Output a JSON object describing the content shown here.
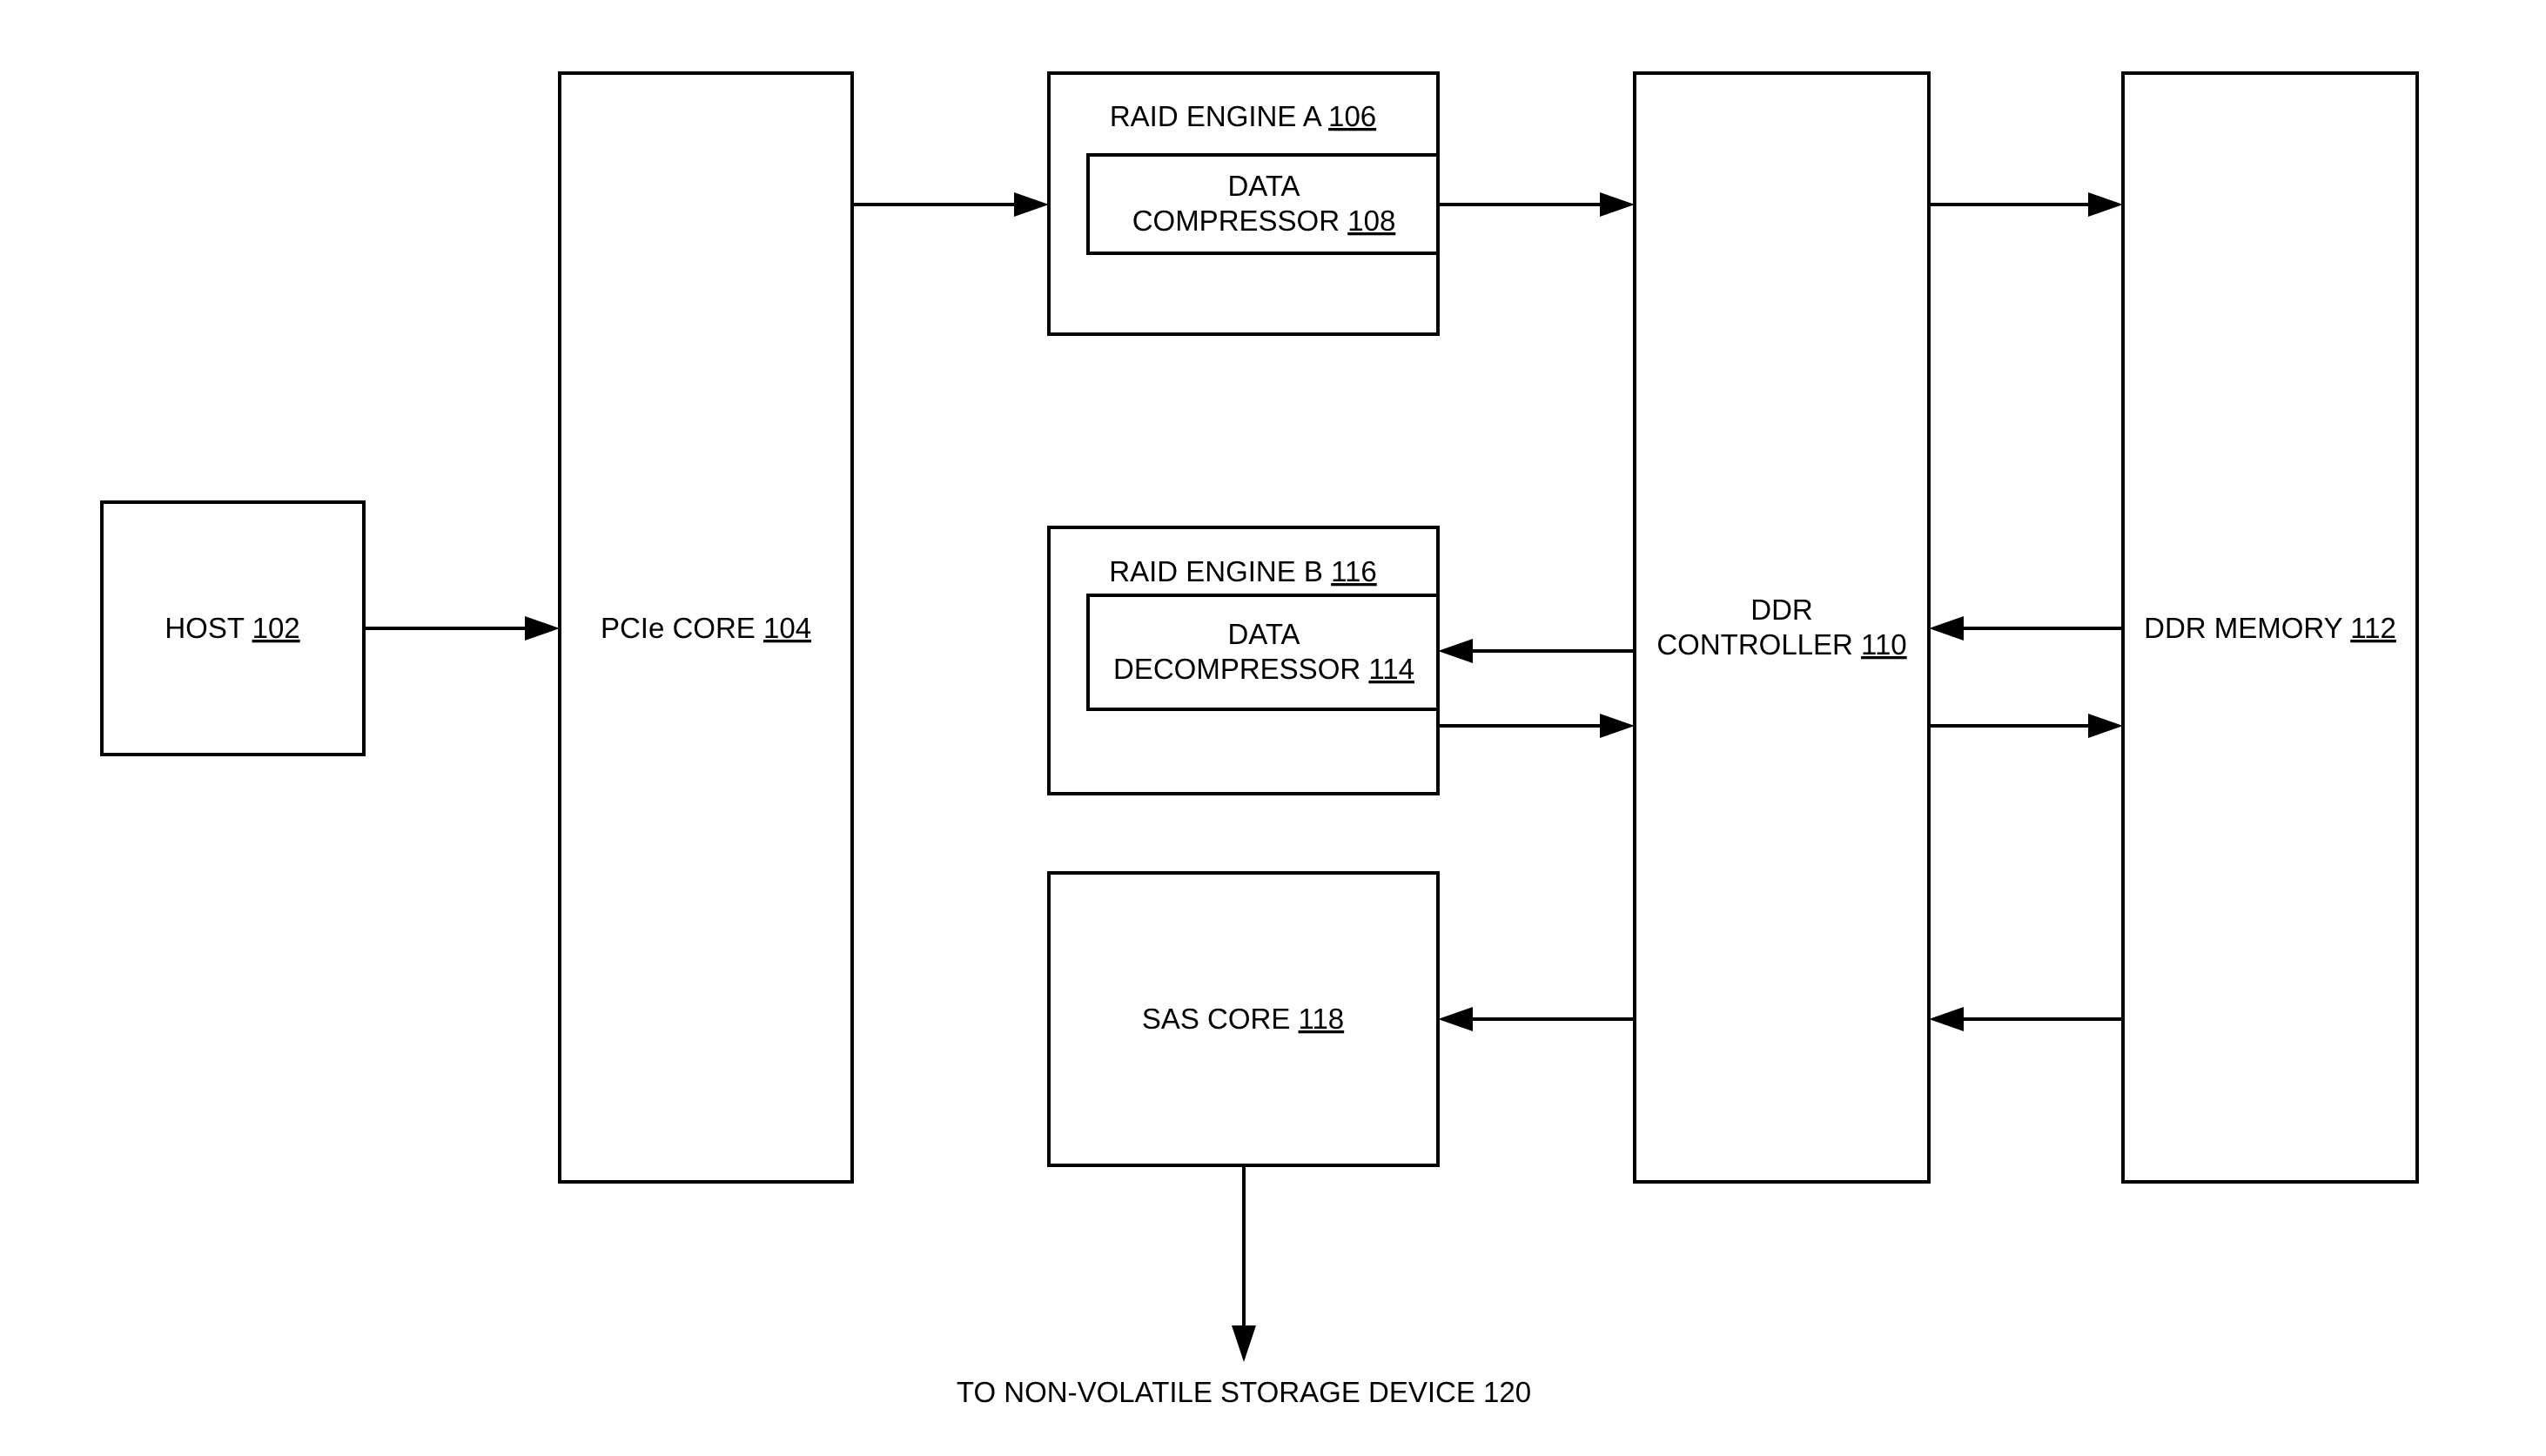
{
  "diagram": {
    "host": {
      "label": "HOST",
      "ref": "102"
    },
    "pcie": {
      "label": "PCIe CORE",
      "ref": "104"
    },
    "raid_a": {
      "label": "RAID ENGINE A",
      "ref": "106"
    },
    "compressor": {
      "line1": "DATA",
      "label": "COMPRESSOR",
      "ref": "108"
    },
    "ddr_controller": {
      "line1": "DDR",
      "label": "CONTROLLER",
      "ref": "110"
    },
    "ddr_memory": {
      "label": "DDR MEMORY",
      "ref": "112"
    },
    "decompressor": {
      "line1": "DATA",
      "label": "DECOMPRESSOR",
      "ref": "114"
    },
    "raid_b": {
      "label": "RAID ENGINE B",
      "ref": "116"
    },
    "sas": {
      "label": "SAS CORE",
      "ref": "118"
    },
    "storage_label": "TO NON-VOLATILE STORAGE DEVICE 120",
    "connections": [
      {
        "from": "HOST 102",
        "to": "PCIe CORE 104"
      },
      {
        "from": "PCIe CORE 104",
        "to": "RAID ENGINE A 106"
      },
      {
        "from": "DATA COMPRESSOR 108",
        "to": "DDR CONTROLLER 110"
      },
      {
        "from": "DDR CONTROLLER 110",
        "to": "DDR MEMORY 112"
      },
      {
        "from": "DDR MEMORY 112",
        "to": "DDR CONTROLLER 110"
      },
      {
        "from": "DDR CONTROLLER 110",
        "to": "DATA DECOMPRESSOR 114"
      },
      {
        "from": "DATA DECOMPRESSOR 114",
        "to": "DDR CONTROLLER 110"
      },
      {
        "from": "DDR CONTROLLER 110",
        "to": "DDR MEMORY 112"
      },
      {
        "from": "DDR MEMORY 112",
        "to": "DDR CONTROLLER 110"
      },
      {
        "from": "DDR CONTROLLER 110",
        "to": "SAS CORE 118"
      },
      {
        "from": "SAS CORE 118",
        "to": "NON-VOLATILE STORAGE DEVICE 120"
      }
    ]
  }
}
